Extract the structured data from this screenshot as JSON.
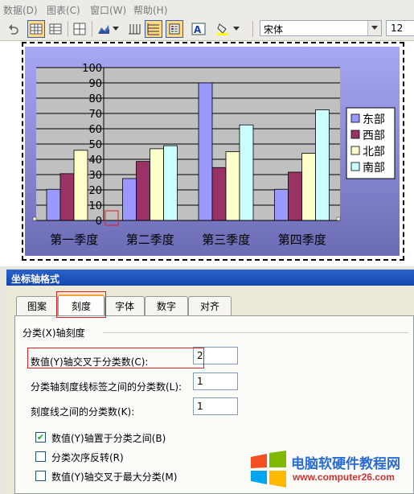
{
  "menu": {
    "items": [
      "数据(D)",
      "图表(C)",
      "窗口(W)",
      "帮助(H)"
    ]
  },
  "toolbar": {
    "font_name": "宋体",
    "font_size": "12"
  },
  "chart_data": {
    "type": "bar",
    "categories": [
      "第一季度",
      "第二季度",
      "第三季度",
      "第四季度"
    ],
    "series": [
      {
        "name": "东部",
        "values": [
          20.4,
          27.4,
          90,
          20.4
        ],
        "color": "#9999ff"
      },
      {
        "name": "西部",
        "values": [
          30.6,
          38.6,
          34.6,
          31.6
        ],
        "color": "#993366"
      },
      {
        "name": "北部",
        "values": [
          45.9,
          46.9,
          45,
          43.9
        ],
        "color": "#ffffcc"
      },
      {
        "name": "南部",
        "values": [
          0,
          48.9,
          62.5,
          72.4
        ],
        "color": "#ccffff"
      }
    ],
    "ylim": [
      0,
      100
    ],
    "yticks": [
      "0",
      "10",
      "20",
      "30",
      "40",
      "50",
      "60",
      "70",
      "80",
      "90",
      "100"
    ],
    "grid": true,
    "legend": "right",
    "colors": {
      "plot_bg": "#c0c0c0",
      "chart_bg_top": "#a7a7f4",
      "chart_bg_bottom": "#6c6cb6"
    }
  },
  "dialog": {
    "title": "坐标轴格式",
    "tabs": [
      {
        "label": "图案",
        "selected": false
      },
      {
        "label": "刻度",
        "selected": true
      },
      {
        "label": "字体",
        "selected": false
      },
      {
        "label": "数字",
        "selected": false
      },
      {
        "label": "对齐",
        "selected": false
      }
    ],
    "group_title": "分类(X)轴刻度",
    "fields": [
      {
        "label": "数值(Y)轴交叉于分类数(C):",
        "value": "2"
      },
      {
        "label": "分类轴刻度线标签之间的分类数(L):",
        "value": "1"
      },
      {
        "label": "刻度线之间的分类数(K):",
        "value": "1"
      }
    ],
    "checkboxes": [
      {
        "label": "数值(Y)轴置于分类之间(B)",
        "checked": true
      },
      {
        "label": "分类次序反转(R)",
        "checked": false
      },
      {
        "label": "数值(Y)轴交叉于最大分类(M)",
        "checked": false
      }
    ]
  },
  "watermark": {
    "name": "电脑软硬件教程网",
    "url": "www.computer26.com"
  }
}
